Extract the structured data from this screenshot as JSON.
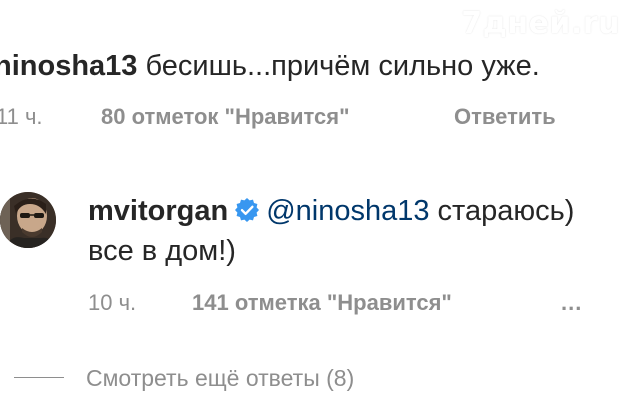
{
  "watermark": "7дней.ru",
  "comment": {
    "username": "ninosha13",
    "text": " бесишь...причём сильно уже.",
    "time": "11 ч.",
    "likes": "80 отметок \"Нравится\"",
    "reply_label": "Ответить"
  },
  "reply": {
    "avatar_icon": "user-avatar",
    "username": "mvitorgan",
    "verified_icon": "verified-badge-icon",
    "verified_color": "#3897f0",
    "mention": "@ninosha13",
    "text_line1_rest": " стараюсь)",
    "text_line2": "все в дом!)",
    "time": "10 ч.",
    "likes": "141 отметка \"Нравится\"",
    "more": "..."
  },
  "view_more_replies": "Смотреть ещё ответы (8)"
}
